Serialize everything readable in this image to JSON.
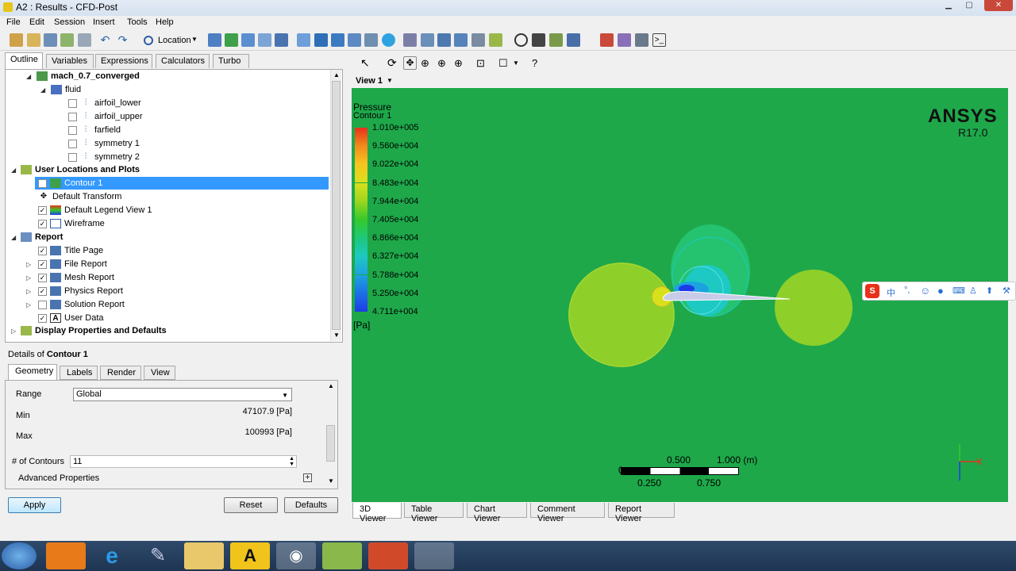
{
  "window": {
    "title": "A2 : Results - CFD-Post"
  },
  "menu": [
    "File",
    "Edit",
    "Session",
    "Insert",
    "Tools",
    "Help"
  ],
  "toolbar": {
    "location_label": "Location"
  },
  "outline_tabs": [
    "Outline",
    "Variables",
    "Expressions",
    "Calculators",
    "Turbo"
  ],
  "tree": {
    "case": "mach_0.7_converged",
    "domain": "fluid",
    "boundaries": [
      "airfoil_lower",
      "airfoil_upper",
      "farfield",
      "symmetry 1",
      "symmetry 2"
    ],
    "user_locations": "User Locations and Plots",
    "user_items": [
      "Contour 1",
      "Default Transform",
      "Default Legend View 1",
      "Wireframe"
    ],
    "report": "Report",
    "report_items": [
      "Title Page",
      "File Report",
      "Mesh Report",
      "Physics Report",
      "Solution Report",
      "User Data"
    ],
    "display": "Display Properties and Defaults"
  },
  "details": {
    "prefix": "Details of ",
    "name": "Contour 1",
    "tabs": [
      "Geometry",
      "Labels",
      "Render",
      "View"
    ],
    "range_label": "Range",
    "range_value": "Global",
    "min_label": "Min",
    "min_value": "47107.9 [Pa]",
    "max_label": "Max",
    "max_value": "100993 [Pa]",
    "contours_label": "# of Contours",
    "contours_value": "11",
    "advanced": "Advanced Properties",
    "apply": "Apply",
    "reset": "Reset",
    "defaults": "Defaults"
  },
  "viewer": {
    "view_label": "View 1",
    "legend_title": "Pressure",
    "legend_subtitle": "Contour 1",
    "legend_values": [
      "1.010e+005",
      "9.560e+004",
      "9.022e+004",
      "8.483e+004",
      "7.944e+004",
      "7.405e+004",
      "6.866e+004",
      "6.327e+004",
      "5.788e+004",
      "5.250e+004",
      "4.711e+004"
    ],
    "legend_colors": [
      "#e8301a",
      "#f28a1d",
      "#f7c51e",
      "#d8e01c",
      "#9cd61e",
      "#36c92c",
      "#1dc87a",
      "#1dc9c2",
      "#1da2e0",
      "#1d6fe8",
      "#1d3ce8"
    ],
    "legend_unit": "[Pa]",
    "brand": "ANSYS",
    "version": "R17.0",
    "scale_labels_top": [
      "0",
      "0.500",
      "1.000 (m)"
    ],
    "scale_labels_bottom": [
      "0.250",
      "0.750"
    ],
    "bottom_tabs": [
      "3D Viewer",
      "Table Viewer",
      "Chart Viewer",
      "Comment Viewer",
      "Report Viewer"
    ]
  },
  "ime": {
    "label": "中"
  }
}
